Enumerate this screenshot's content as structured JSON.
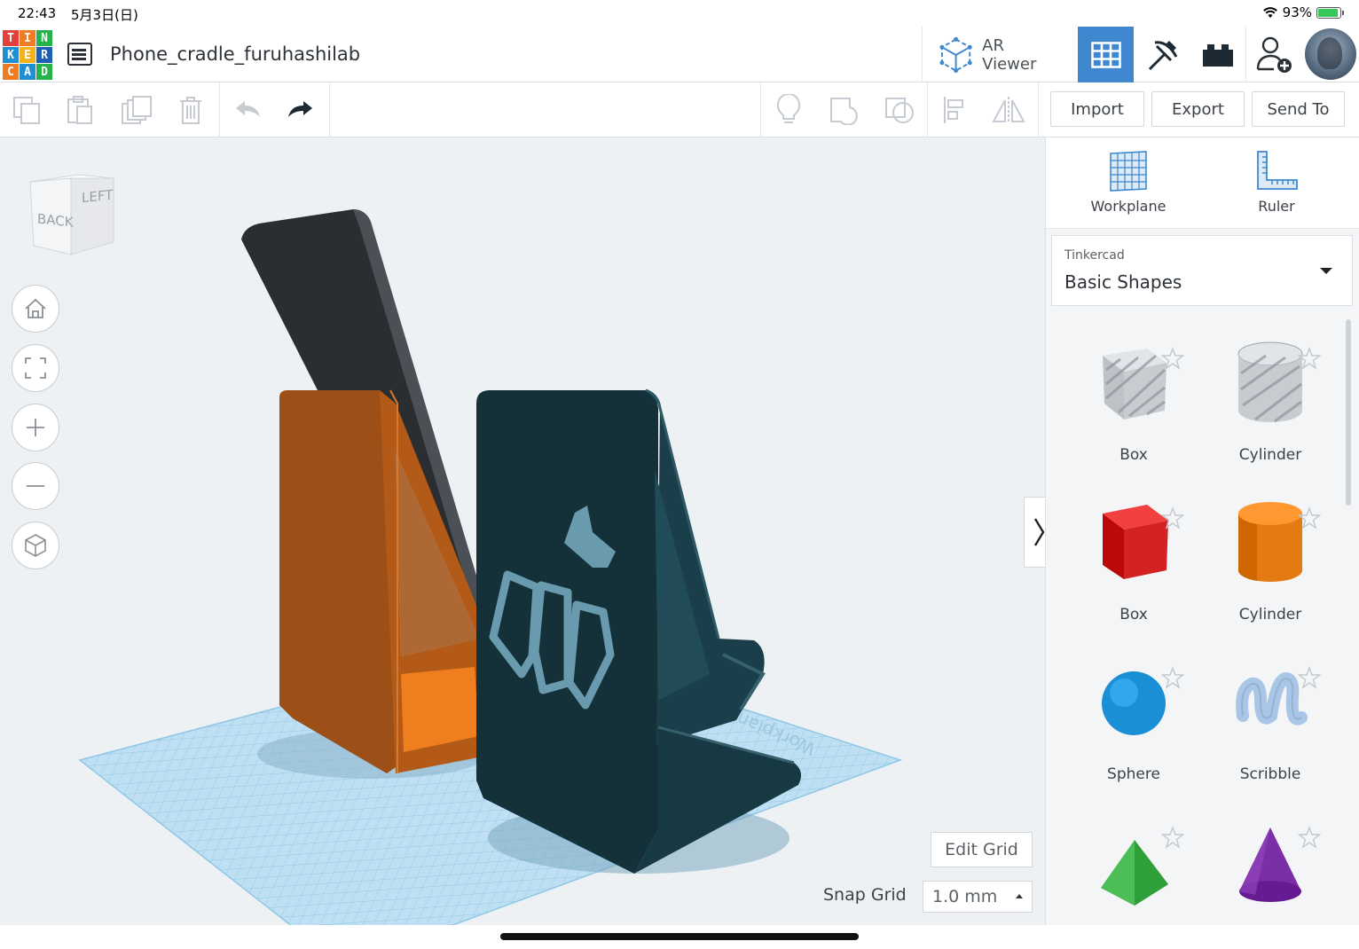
{
  "status_bar": {
    "time": "22:43",
    "date": "5月3日(日)",
    "battery": "93%",
    "battery_level": 0.93
  },
  "header": {
    "logo_letters": [
      "T",
      "I",
      "N",
      "K",
      "E",
      "R",
      "C",
      "A",
      "D"
    ],
    "project_title": "Phone_cradle_furuhashilab",
    "ar_viewer_label": "AR Viewer"
  },
  "toolbar": {
    "import_label": "Import",
    "export_label": "Export",
    "send_to_label": "Send To"
  },
  "viewcube": {
    "back_label": "BACK",
    "left_label": "LEFT"
  },
  "workspace": {
    "edit_grid_label": "Edit Grid",
    "snap_grid_label": "Snap Grid",
    "snap_grid_value": "1.0 mm",
    "workplane_watermark": "Workplane"
  },
  "panel": {
    "workplane_label": "Workplane",
    "ruler_label": "Ruler",
    "library_category": "Tinkercad",
    "library_value": "Basic Shapes",
    "shapes": [
      {
        "label": "Box",
        "color": "#c8ccd0",
        "kind": "box-hole"
      },
      {
        "label": "Cylinder",
        "color": "#c8ccd0",
        "kind": "cylinder-hole"
      },
      {
        "label": "Box",
        "color": "#d42222",
        "kind": "box"
      },
      {
        "label": "Cylinder",
        "color": "#e37a12",
        "kind": "cylinder"
      },
      {
        "label": "Sphere",
        "color": "#1b8fd6",
        "kind": "sphere"
      },
      {
        "label": "Scribble",
        "color": "#a9c6e6",
        "kind": "scribble"
      },
      {
        "label": "",
        "color": "#2f9f3a",
        "kind": "roof"
      },
      {
        "label": "",
        "color": "#7b2fa6",
        "kind": "cone"
      }
    ]
  },
  "colors": {
    "accent": "#3f88cf",
    "workplane": "#b9dcf1",
    "orange_part": "#c9661a",
    "teal_part": "#17363f",
    "gray_part": "#33383c"
  }
}
